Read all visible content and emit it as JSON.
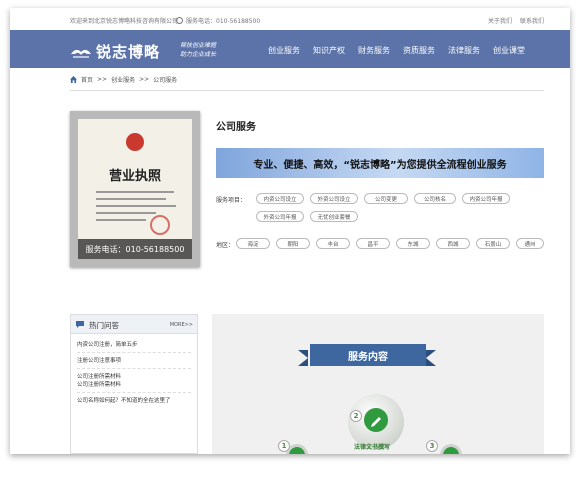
{
  "topbar": {
    "welcome": "欢迎来到北京锐志博略科技咨询有限公司",
    "phone": "服务电话：010-56188500",
    "links": [
      "关于我们",
      "联系我们"
    ]
  },
  "logo": {
    "name": "锐志博略",
    "slogan_line1": "帮扶创业难题",
    "slogan_line2": "助力企业成长"
  },
  "nav": [
    "创业服务",
    "知识产权",
    "财务服务",
    "资质服务",
    "法律服务",
    "创业课堂"
  ],
  "breadcrumb": [
    "首页",
    "创业服务",
    "公司服务"
  ],
  "breadcrumb_sep": ">>",
  "licence": {
    "title": "营业执照",
    "tel": "服务电话：010-56188500"
  },
  "service": {
    "title": "公司服务",
    "banner": "专业、便捷、高效，“锐志博略”为您提供全流程创业服务",
    "items_label": "服务项目：",
    "items": [
      "内资公司设立",
      "外资公司设立",
      "公司变更",
      "公司核名",
      "内资公司年报",
      "外资公司年报",
      "无忧创业套餐"
    ],
    "area_label": "地区：",
    "areas": [
      "海淀",
      "朝阳",
      "丰台",
      "昌平",
      "东城",
      "西城",
      "石景山",
      "通州"
    ]
  },
  "qa": {
    "title": "热门问答",
    "more": "MORE>>",
    "items": [
      "内资公司注册，简单五步",
      "注册公司注意事项",
      "公司注册所需材料\n公司注册所需材料",
      "公司名称如何起？不知道的全在这里了"
    ]
  },
  "content": {
    "ribbon": "服务内容",
    "steps": [
      {
        "num": "1"
      },
      {
        "num": "2",
        "caption": "法律文书撰写"
      },
      {
        "num": "3"
      }
    ]
  },
  "colors": {
    "nav": "#5b73a9",
    "ribbon": "#3e679f",
    "accent_green": "#2f9a3e"
  }
}
